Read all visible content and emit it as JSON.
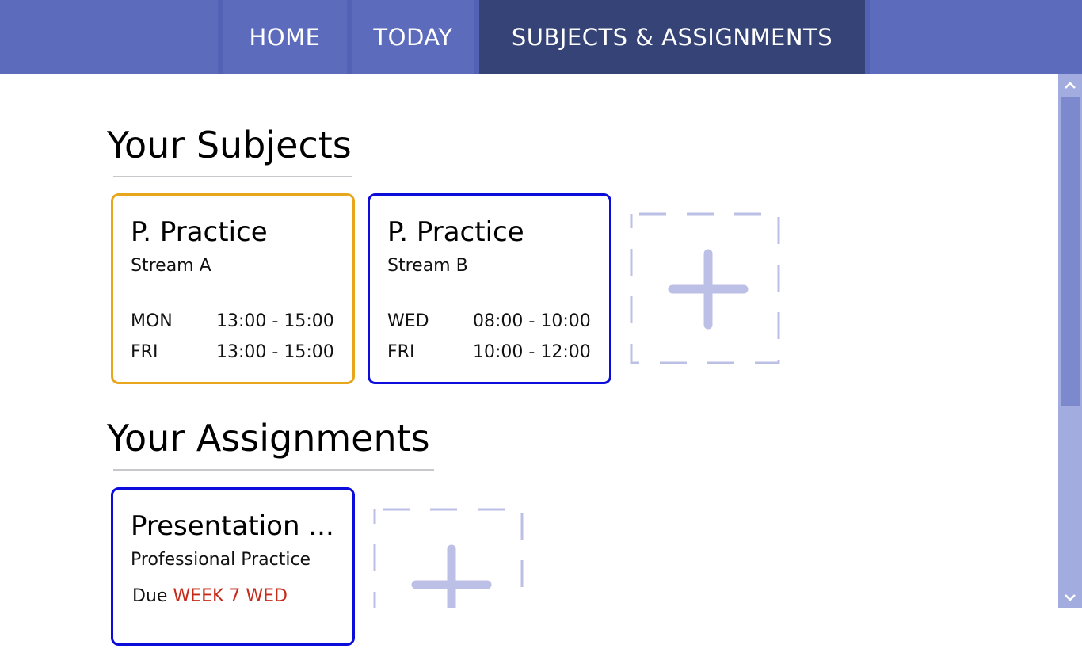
{
  "nav": {
    "tabs": [
      {
        "label": "HOME",
        "active": false
      },
      {
        "label": "TODAY",
        "active": false
      },
      {
        "label": "SUBJECTS & ASSIGNMENTS",
        "active": true
      }
    ]
  },
  "subjects": {
    "title": "Your Subjects",
    "cards": [
      {
        "title": "P. Practice",
        "stream": "Stream A",
        "border_color": "#e8a61c",
        "schedule": [
          {
            "day": "MON",
            "time": "13:00 - 15:00"
          },
          {
            "day": "FRI",
            "time": "13:00 - 15:00"
          }
        ]
      },
      {
        "title": "P. Practice",
        "stream": "Stream B",
        "border_color": "#0c0cdb",
        "schedule": [
          {
            "day": "WED",
            "time": "08:00 - 10:00"
          },
          {
            "day": "FRI",
            "time": "10:00 - 12:00"
          }
        ]
      }
    ],
    "add_icon": "plus-icon"
  },
  "assignments": {
    "title": "Your Assignments",
    "cards": [
      {
        "title": "Presentation ...",
        "subject": "Professional Practice",
        "due_label": "Due",
        "due_value": "WEEK 7 WED",
        "border_color": "#0c0cdb"
      }
    ],
    "add_icon": "plus-icon"
  },
  "colors": {
    "nav_bg": "#5d6bbd",
    "nav_active": "#364377",
    "add_tile": "#bcc0e6",
    "due_text": "#c62b1a",
    "scrollbar_track": "#a3acdf",
    "scrollbar_thumb": "#7c89cd"
  }
}
